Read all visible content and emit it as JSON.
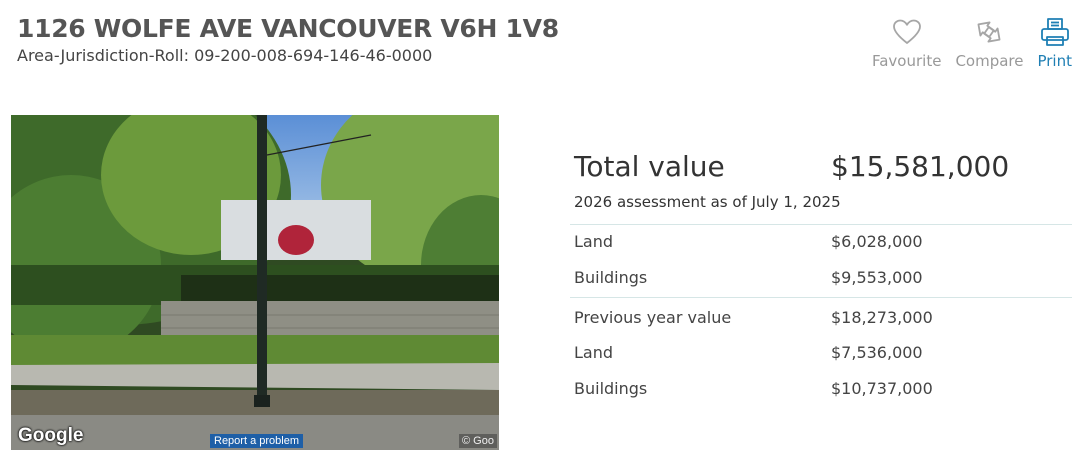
{
  "property": {
    "address": "1126 WOLFE AVE VANCOUVER V6H 1V8",
    "roll": "Area-Jurisdiction-Roll: 09-200-008-694-146-46-0000"
  },
  "actions": {
    "favourite": {
      "label": "Favourite",
      "icon": "heart-icon"
    },
    "compare": {
      "label": "Compare",
      "icon": "compare-arrows-icon"
    },
    "print": {
      "label": "Print",
      "icon": "printer-icon"
    }
  },
  "colors": {
    "accent": "#1f7fb4",
    "muted_label": "#999999",
    "report_bg": "#1e5fa7"
  },
  "street_view": {
    "logo": "Google",
    "report": "Report a problem",
    "copyright": "© Goo"
  },
  "valuation": {
    "total_label": "Total value",
    "total_amount": "$15,581,000",
    "assessment_date": "2026 assessment as of July 1, 2025",
    "current": [
      {
        "label": "Land",
        "value": "$6,028,000"
      },
      {
        "label": "Buildings",
        "value": "$9,553,000"
      }
    ],
    "previous": [
      {
        "label": "Previous year value",
        "value": "$18,273,000"
      },
      {
        "label": "Land",
        "value": "$7,536,000"
      },
      {
        "label": "Buildings",
        "value": "$10,737,000"
      }
    ]
  }
}
